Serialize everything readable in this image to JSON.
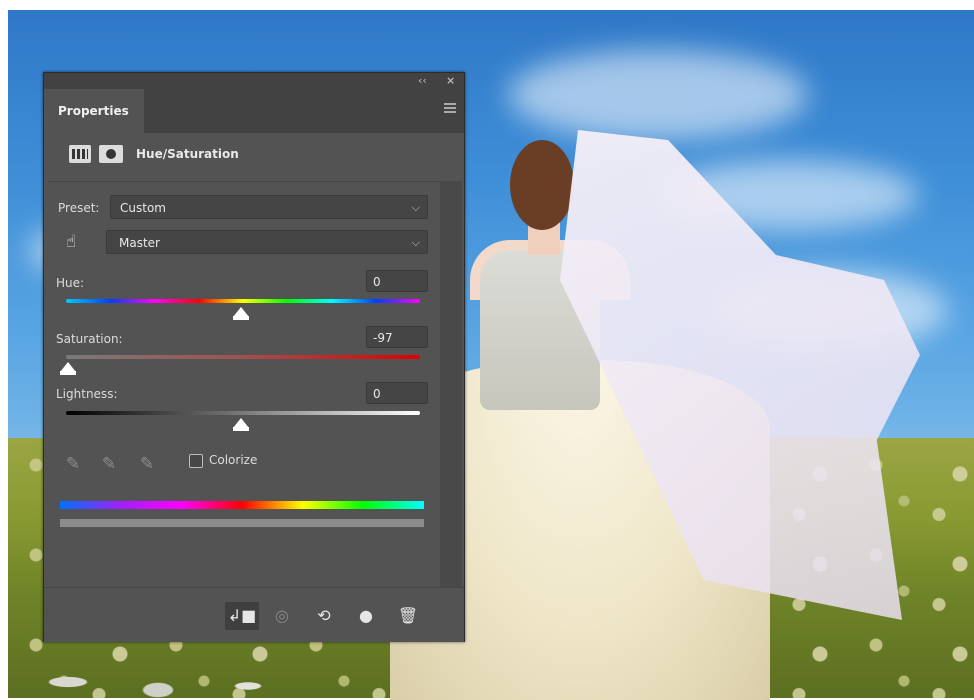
{
  "panel": {
    "tab_label": "Properties",
    "collapse_glyph": "‹‹",
    "close_glyph": "×",
    "adjustment_title": "Hue/Saturation"
  },
  "preset": {
    "label": "Preset:",
    "value": "Custom"
  },
  "channel": {
    "value": "Master"
  },
  "hue": {
    "label": "Hue:",
    "value": "0"
  },
  "saturation": {
    "label": "Saturation:",
    "value": "-97"
  },
  "lightness": {
    "label": "Lightness:",
    "value": "0"
  },
  "colorize": {
    "label": "Colorize",
    "checked": false
  },
  "icons": {
    "layer": "layer-adjustment-icon",
    "mask": "layer-mask-icon",
    "target": "targeted-adjustment-hand-icon",
    "eyedropper": "eyedropper-icon",
    "eyedropper_add": "eyedropper-add-icon",
    "eyedropper_sub": "eyedropper-subtract-icon",
    "clip": "clip-to-layer-icon",
    "view_previous": "view-previous-state-icon",
    "reset": "reset-icon",
    "visibility": "eye-icon",
    "delete": "trash-icon"
  },
  "footer": {
    "clip_glyph": "↲■",
    "view_glyph": "◎",
    "reset_glyph": "⟲",
    "eye_glyph": "●",
    "trash_glyph": "🗑"
  }
}
